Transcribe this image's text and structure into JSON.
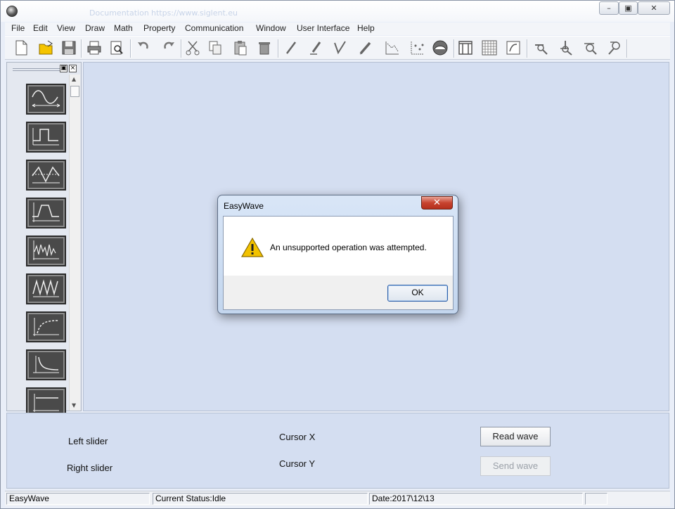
{
  "window": {
    "faint_titlebar_texts": [
      "Documentation",
      "https://www.siglent.eu"
    ],
    "minimize_glyph": "–",
    "restore_glyph": "▣",
    "close_glyph": "✕"
  },
  "menu": [
    "File",
    "Edit",
    "View",
    "Draw",
    "Math",
    "Property",
    "Communication",
    "Window",
    "User Interface",
    "Help"
  ],
  "toolbar_icons": [
    "new-file-icon",
    "open-folder-icon",
    "save-icon",
    "print-icon",
    "print-preview-icon",
    "undo-icon",
    "redo-icon",
    "cut-icon",
    "copy-icon",
    "paste-icon",
    "delete-icon",
    "line-draw-icon",
    "pen-draw-icon",
    "point-draw-icon",
    "freehand-draw-icon",
    "point-edit-icon",
    "point-scatter-icon",
    "fill-icon",
    "column-icon",
    "grid-icon",
    "zoom-fit-icon",
    "zoom-horizontal-icon",
    "zoom-vertical-icon",
    "zoom-in-icon",
    "zoom-out-icon"
  ],
  "side_panel": {
    "restore_glyph": "▣",
    "close_glyph": "×",
    "waveforms": [
      "sine-wave-icon",
      "square-wave-icon",
      "triangle-wave-icon",
      "pulse-wave-icon",
      "noise-wave-icon",
      "sawtooth-wave-icon",
      "exp-rise-icon",
      "exp-fall-icon",
      "dc-icon"
    ]
  },
  "dialog": {
    "title": "EasyWave",
    "close_glyph": "✕",
    "message": "An unsupported operation was attempted.",
    "ok_label": "OK",
    "icon": "warning-icon"
  },
  "bottom": {
    "left_slider": "Left slider",
    "right_slider": "Right slider",
    "cursor_x": "Cursor X",
    "cursor_y": "Cursor Y",
    "read_wave": "Read wave",
    "send_wave": "Send wave"
  },
  "status": {
    "app": "EasyWave",
    "current_status": "Current Status:Idle",
    "date": "Date:2017\\12\\13"
  },
  "colors": {
    "canvas": "#d4def1",
    "dialog_close": "#c7432f",
    "warning": "#f2c200"
  }
}
